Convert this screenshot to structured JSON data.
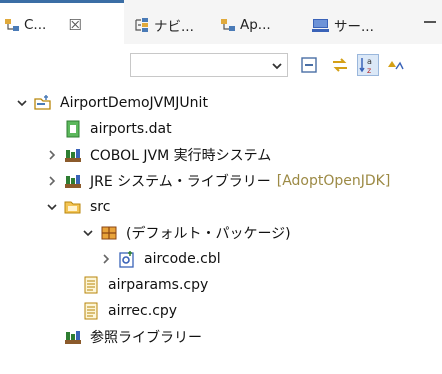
{
  "tabs": [
    {
      "label": "C...",
      "close_glyph": "☒"
    },
    {
      "label": "ナビ..."
    },
    {
      "label": "Ap..."
    },
    {
      "label": "サー..."
    }
  ],
  "toolbar": {
    "filter_value": "",
    "filter_placeholder": ""
  },
  "tree": {
    "project": "AirportDemoJVMJUnit",
    "items": [
      {
        "label": "airports.dat"
      },
      {
        "label": "COBOL JVM 実行時システム"
      },
      {
        "label": "JRE システム・ライブラリー",
        "decoration": "[AdoptOpenJDK]"
      },
      {
        "label": "src"
      },
      {
        "label": "(デフォルト・パッケージ)"
      },
      {
        "label": "aircode.cbl"
      },
      {
        "label": "airparams.cpy"
      },
      {
        "label": "airrec.cpy"
      },
      {
        "label": "参照ライブラリー"
      }
    ]
  },
  "colors": {
    "tab_accent": "#3b6ea5",
    "decoration": "#9c8a45",
    "folder": "#e0a93b",
    "library_green": "#2e7d32"
  }
}
